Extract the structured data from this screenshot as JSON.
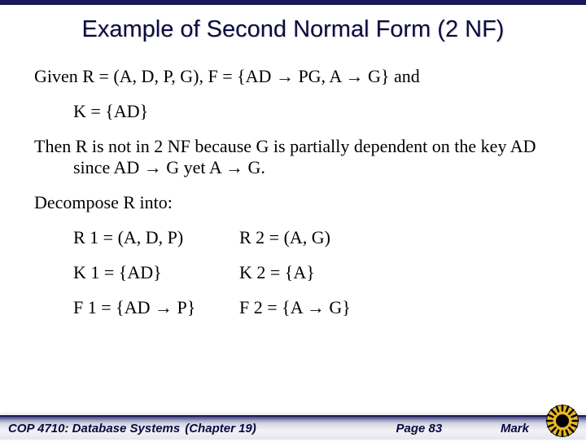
{
  "title": "Example of Second Normal Form (2 NF)",
  "content": {
    "given_prefix": "Given R = (A, D, P, G), F = {AD ",
    "given_mid": " PG, A ",
    "given_suffix": " G} and",
    "key_line": "K = {AD}",
    "then_l1_a": "Then R is not in 2 NF because G is partially dependent on ",
    "then_l2_a": "the key AD since AD ",
    "then_l2_b": " G yet A ",
    "then_l2_c": " G.",
    "decompose": "Decompose R into:",
    "r1": "R 1 = (A, D, P)",
    "r2": "R 2 = (A, G)",
    "k1": "K 1 = {AD}",
    "k2": "K 2 = {A}",
    "f1_a": "F 1 = {AD ",
    "f1_b": " P}",
    "f2_a": "F 2 = {A ",
    "f2_b": " G}"
  },
  "footer": {
    "course": "COP 4710: Database Systems",
    "chapter": "(Chapter 19)",
    "page": "Page 83",
    "author": "Mark"
  },
  "glyphs": {
    "arrow": "→"
  }
}
